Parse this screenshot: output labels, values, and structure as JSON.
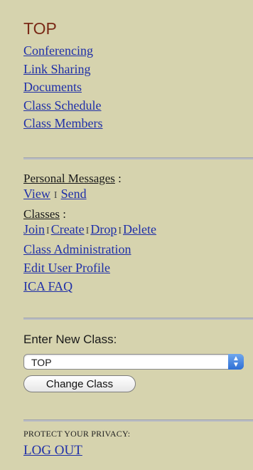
{
  "sidebar": {
    "title": "TOP",
    "nav": [
      "Conferencing",
      "Link Sharing",
      "Documents",
      "Class Schedule",
      "Class Members"
    ],
    "personal_messages": {
      "label": "Personal Messages",
      "suffix": " :",
      "view": "View",
      "sep": "I",
      "send": "Send"
    },
    "classes": {
      "label": "Classes",
      "suffix": " :",
      "join": "Join",
      "create": "Create",
      "drop": "Drop",
      "delete": "Delete",
      "sep": "I"
    },
    "more_links": [
      "Class Administration",
      "Edit User Profile",
      "ICA FAQ"
    ],
    "enter_class": {
      "label": "Enter New Class:",
      "selected": "TOP",
      "button": "Change Class"
    },
    "privacy": {
      "label": "PROTECT YOUR PRIVACY:",
      "logout": "LOG OUT"
    }
  }
}
